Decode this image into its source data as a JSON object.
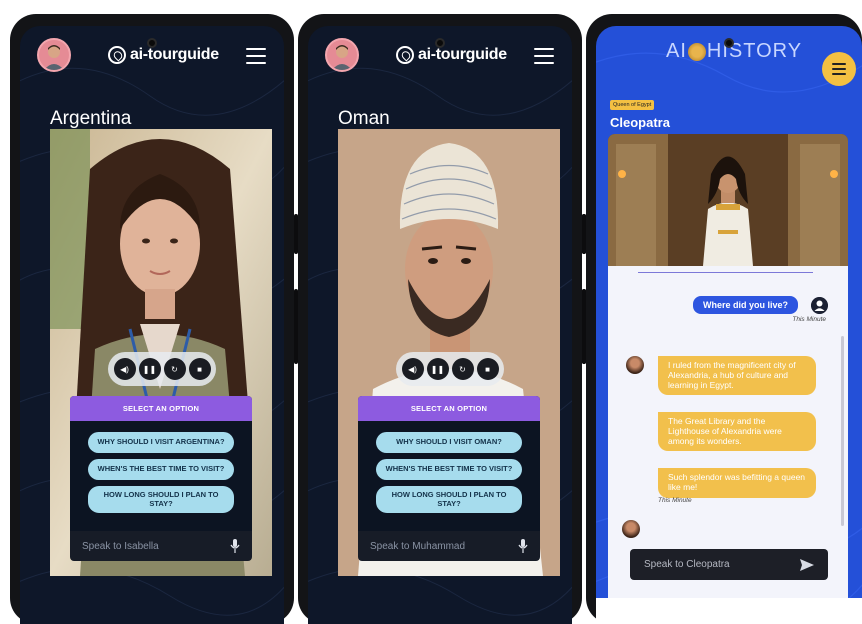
{
  "phones": [
    {
      "app_logo": "ai-tourguide",
      "country": "Argentina",
      "controls": [
        "volume-icon",
        "pause-icon",
        "replay-icon",
        "stop-icon"
      ],
      "options_header": "SELECT AN OPTION",
      "options": [
        "WHY SHOULD I VISIT ARGENTINA?",
        "WHEN'S THE BEST TIME TO VISIT?",
        "HOW LONG SHOULD I PLAN TO STAY?"
      ],
      "speak_placeholder": "Speak to Isabella"
    },
    {
      "app_logo": "ai-tourguide",
      "country": "Oman",
      "controls": [
        "volume-icon",
        "pause-icon",
        "replay-icon",
        "stop-icon"
      ],
      "options_header": "SELECT AN OPTION",
      "options": [
        "WHY SHOULD I VISIT OMAN?",
        "WHEN'S THE BEST TIME TO VISIT?",
        "HOW LONG SHOULD I PLAN TO STAY?"
      ],
      "speak_placeholder": "Speak to Muhammad"
    }
  ],
  "history": {
    "logo_left": "AI",
    "logo_right": "HISTORY",
    "badge": "Queen of Egypt",
    "name": "Cleopatra",
    "user_message": "Where did you live?",
    "user_time": "This Minute",
    "bot_messages": [
      "I ruled from the magnificent city of Alexandria, a hub of culture and learning in Egypt.",
      "The Great Library and the Lighthouse of Alexandria were among its wonders.",
      "Such splendor was befitting a queen like me!"
    ],
    "bot_time": "This Minute",
    "input_placeholder": "Speak to Cleopatra"
  },
  "colors": {
    "tourguide_bg": "#0e1729",
    "options_header": "#8d5be0",
    "option_button": "#a6dced",
    "history_bg": "#2450d8",
    "history_accent": "#f3c042",
    "user_bubble": "#2d55e0"
  }
}
